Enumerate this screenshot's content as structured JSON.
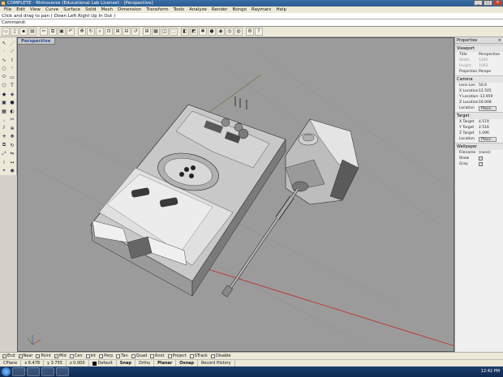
{
  "window": {
    "title": "COMPLETE - Rhinoceros (Educational Lab License) - [Perspective]"
  },
  "menu": [
    "File",
    "Edit",
    "View",
    "Curve",
    "Surface",
    "Solid",
    "Mesh",
    "Dimension",
    "Transform",
    "Tools",
    "Analyze",
    "Render",
    "Bongo",
    "Raymarx",
    "Help"
  ],
  "command_history": "Click and drag to pan ( Down  Left  Right  Up  In  Out )",
  "command_prompt": "Command:",
  "viewport": {
    "tab_label": "Perspective"
  },
  "properties": {
    "title": "Properties",
    "viewport_section": "Viewport",
    "title_label": "Title",
    "title_value": "Perspective",
    "width_label": "Width",
    "width_value": "1265",
    "height_label": "Height",
    "height_value": "1003",
    "projection_label": "Projection",
    "projection_value": "Perspe",
    "camera_section": "Camera",
    "lens_label": "Lens Len",
    "lens_value": "50.0",
    "xloc_label": "X Location",
    "xloc_value": "12.505",
    "yloc_label": "Y Location",
    "yloc_value": "-13.959",
    "zloc_label": "Z Location",
    "zloc_value": "16.008",
    "location_label": "Location",
    "place_btn": "Place...",
    "target_section": "Target",
    "xtarget_label": "X Target",
    "xtarget_value": "4.574",
    "ytarget_label": "Y Target",
    "ytarget_value": "2.516",
    "ztarget_label": "Z Target",
    "ztarget_value": "1.096",
    "tlocation_label": "Location",
    "tplace_btn": "Place...",
    "wallpaper_section": "Wallpaper",
    "filename_label": "Filename",
    "filename_value": "(none)",
    "show_label": "Show",
    "gray_label": "Gray"
  },
  "osnaps": [
    {
      "label": "End",
      "on": true
    },
    {
      "label": "Near",
      "on": true
    },
    {
      "label": "Point",
      "on": true
    },
    {
      "label": "Mid",
      "on": true
    },
    {
      "label": "Cen",
      "on": false
    },
    {
      "label": "Int",
      "on": false
    },
    {
      "label": "Perp",
      "on": false
    },
    {
      "label": "Tan",
      "on": false
    },
    {
      "label": "Quad",
      "on": false
    },
    {
      "label": "Knot",
      "on": false
    },
    {
      "label": "Project",
      "on": false
    },
    {
      "label": "STrack",
      "on": false
    },
    {
      "label": "Disable",
      "on": false
    }
  ],
  "status": {
    "cplane": "CPlane",
    "x": "x 6.478",
    "y": "y 3.755",
    "z": "z 0.000",
    "layer": "Default",
    "snap": "Snap",
    "ortho": "Ortho",
    "planar": "Planar",
    "osnap": "Osnap",
    "record_history": "Record History"
  },
  "clock": "12:42 PM",
  "colors": {
    "viewport_bg": "#9b9b9b",
    "x_axis": "#c0281e",
    "grid_line": "#8a8a8a",
    "model_light": "#e8e8e8",
    "model_mid": "#b8b8b8",
    "model_dark": "#4a4a4a"
  }
}
